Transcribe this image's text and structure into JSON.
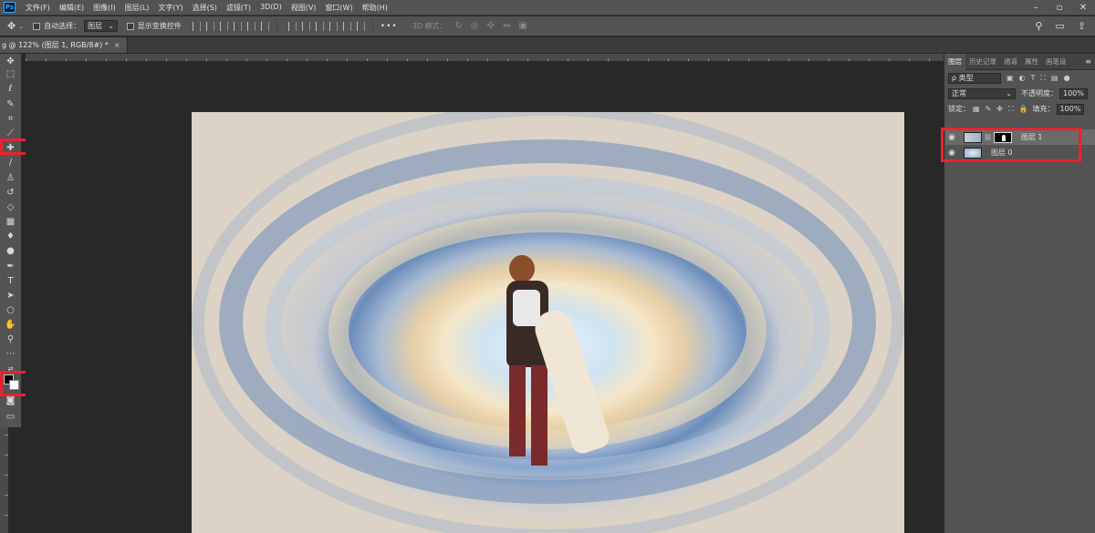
{
  "app": {
    "logo": "Ps"
  },
  "menu": [
    "文件(F)",
    "编辑(E)",
    "图像(I)",
    "图层(L)",
    "文字(Y)",
    "选择(S)",
    "滤镜(T)",
    "3D(D)",
    "视图(V)",
    "窗口(W)",
    "帮助(H)"
  ],
  "window_controls": {
    "minimize": "–",
    "restore": "▫",
    "close": "✕"
  },
  "options": {
    "auto_select_label": "自动选择：",
    "auto_select_value": "图层",
    "transform_label": "显示变换控件",
    "more": "•••",
    "mode_3d": "3D 模式："
  },
  "document": {
    "tab_title": "g @ 122% (图层 1, RGB/8#) *",
    "close": "×"
  },
  "panel": {
    "tabs": [
      "图层",
      "历史记录",
      "通道",
      "属性",
      "画笔设"
    ],
    "filter_label": "ρ 类型",
    "blend_mode": "正常",
    "opacity_label": "不透明度：",
    "opacity_value": "100%",
    "lock_label": "锁定：",
    "fill_label": "填充：",
    "fill_value": "100%",
    "layers": [
      {
        "name": "图层 1",
        "selected": true,
        "has_mask": true
      },
      {
        "name": "图层 0",
        "selected": false,
        "has_mask": false
      }
    ]
  },
  "colors": {
    "highlight": "#e8232e",
    "foreground": "#000000",
    "background": "#ffffff"
  }
}
